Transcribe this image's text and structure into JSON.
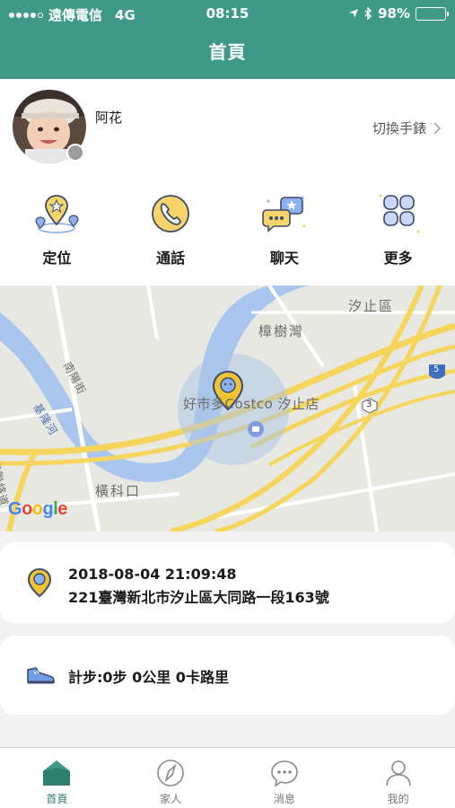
{
  "status_bar": {
    "carrier": "遠傳電信",
    "network": "4G",
    "time": "08:15",
    "battery": "98%",
    "battery_level": 0.98
  },
  "header": {
    "title": "首頁"
  },
  "profile": {
    "name": "阿花",
    "switch_label": "切換手錶",
    "status_color": "#9c9c9c"
  },
  "menu": [
    {
      "label": "定位",
      "icon": "location-pins-icon"
    },
    {
      "label": "通話",
      "icon": "phone-call-icon"
    },
    {
      "label": "聊天",
      "icon": "chat-bubbles-icon"
    },
    {
      "label": "更多",
      "icon": "more-grid-icon"
    }
  ],
  "map": {
    "labels": {
      "xizhi": "汐止區",
      "zhangshuwan": "樟樹灣",
      "nanyang": "南陽街",
      "keelung_river": "基隆河",
      "costco": "好市多Costco 汐止店",
      "hengke": "橫科口",
      "road_route": "南港聯絡道",
      "route_3": "3",
      "route_5": "5"
    },
    "google": "Google"
  },
  "location_card": {
    "timestamp": "2018-08-04 21:09:48",
    "address": "221臺灣新北市汐止區大同路一段163號"
  },
  "step_card": {
    "text": "計步:0步 0公里 0卡路里"
  },
  "tabs": [
    {
      "label": "首頁",
      "icon": "home-icon",
      "active": true
    },
    {
      "label": "家人",
      "icon": "compass-icon",
      "active": false
    },
    {
      "label": "消息",
      "icon": "message-icon",
      "active": false
    },
    {
      "label": "我的",
      "icon": "user-icon",
      "active": false
    }
  ],
  "colors": {
    "accent": "#3e9a87",
    "pin_yellow": "#f2c431",
    "river": "#a9c6ee",
    "road": "#f6d55c"
  }
}
